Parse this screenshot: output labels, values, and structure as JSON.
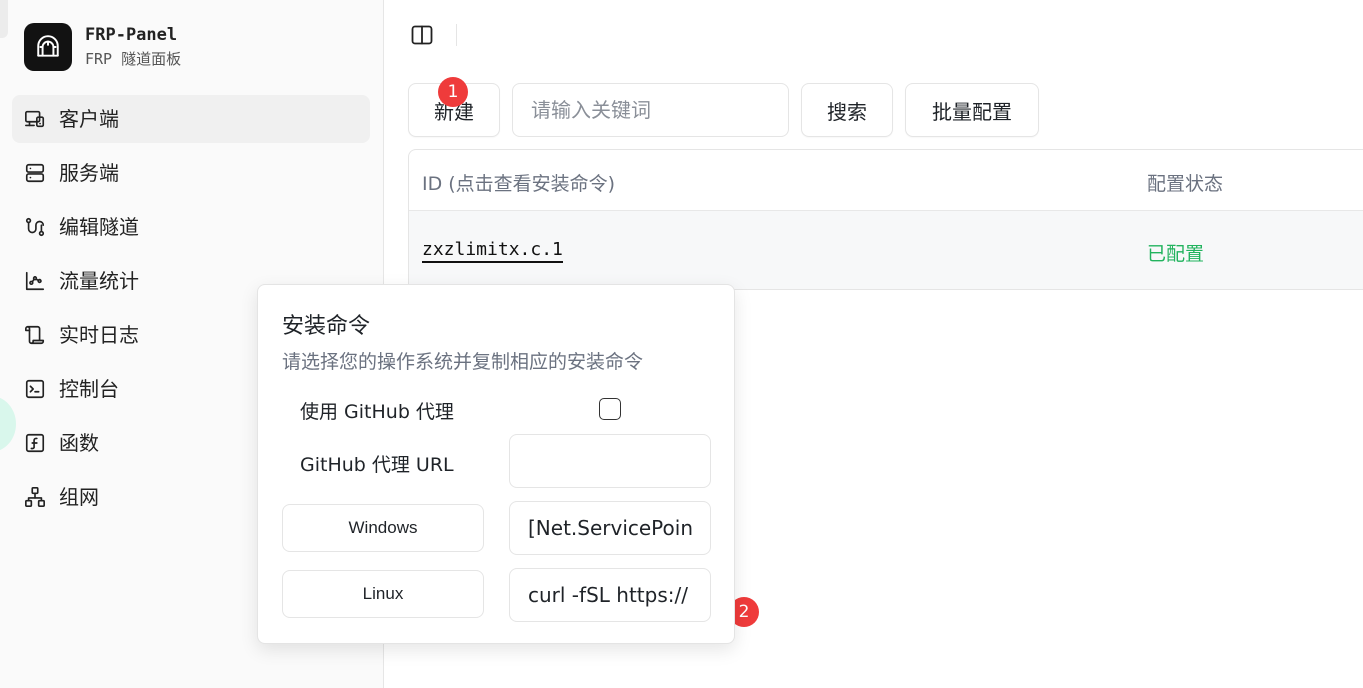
{
  "brand": {
    "title": "FRP-Panel",
    "subtitle": "FRP 隧道面板"
  },
  "sidebar": {
    "items": [
      {
        "label": "客户端",
        "icon": "client-devices-icon",
        "active": true
      },
      {
        "label": "服务端",
        "icon": "server-icon",
        "active": false
      },
      {
        "label": "编辑隧道",
        "icon": "tunnel-route-icon",
        "active": false
      },
      {
        "label": "流量统计",
        "icon": "chart-icon",
        "active": false
      },
      {
        "label": "实时日志",
        "icon": "scroll-log-icon",
        "active": false
      },
      {
        "label": "控制台",
        "icon": "terminal-icon",
        "active": false
      },
      {
        "label": "函数",
        "icon": "function-icon",
        "active": false
      },
      {
        "label": "组网",
        "icon": "network-icon",
        "active": false
      }
    ]
  },
  "toolbar": {
    "new_label": "新建",
    "search_placeholder": "请输入关键词",
    "search_label": "搜索",
    "batch_label": "批量配置",
    "badge_new": "1"
  },
  "table": {
    "columns": [
      "ID (点击查看安装命令)",
      "配置状态"
    ],
    "rows": [
      {
        "id": "zxzlimitx.c.1",
        "status": "已配置"
      }
    ]
  },
  "popover": {
    "title": "安装命令",
    "description": "请选择您的操作系统并复制相应的安装命令",
    "proxy_label": "使用 GitHub 代理",
    "proxy_checked": false,
    "proxy_url_label": "GitHub 代理 URL",
    "proxy_url_value": "",
    "windows_label": "Windows",
    "windows_command": "[Net.ServicePoin",
    "linux_label": "Linux",
    "linux_command": "curl -fSL https://",
    "badge": "2"
  },
  "colors": {
    "accent_badge": "#ef3b3b",
    "status_configured": "#22b35e",
    "logo_bg": "#121212"
  }
}
